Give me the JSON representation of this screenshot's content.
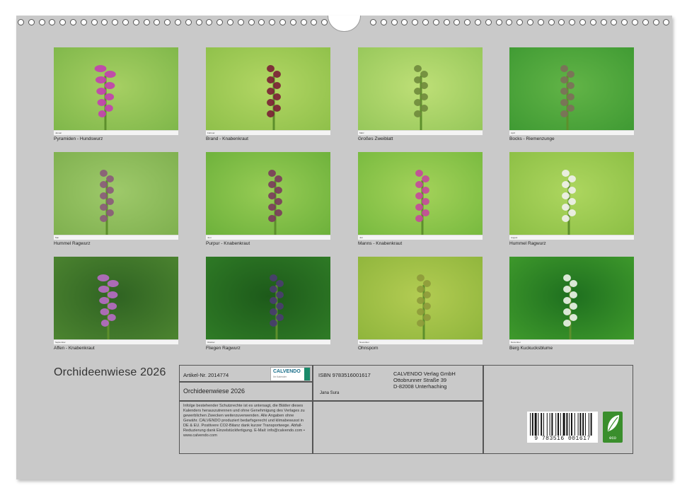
{
  "calendar": {
    "title": "Orchideenwiese  2026"
  },
  "photos": [
    {
      "caption": "Pyramiden - Hundswurz",
      "month": "Januar",
      "icon": "pyramid-orchid-with-hawkmoth"
    },
    {
      "caption": "Brand - Knabenkraut",
      "month": "Februar",
      "icon": "burnt-orchid"
    },
    {
      "caption": "Großes Zweiblatt",
      "month": "März",
      "icon": "twayblade"
    },
    {
      "caption": "Bocks - Riemenzunge",
      "month": "April",
      "icon": "lizard-orchid"
    },
    {
      "caption": "Hummel Ragwurz",
      "month": "Mai",
      "icon": "bee-orchid"
    },
    {
      "caption": "Purpur - Knabenkraut",
      "month": "Juni",
      "icon": "lady-orchid"
    },
    {
      "caption": "Manns - Knabenkraut",
      "month": "Juli",
      "icon": "early-purple-orchid"
    },
    {
      "caption": "Hummel Ragwurz",
      "month": "August",
      "icon": "bee-orchid-pair"
    },
    {
      "caption": "Affen - Knabenkraut",
      "month": "September",
      "icon": "monkey-orchid"
    },
    {
      "caption": "Fliegen Ragwurz",
      "month": "Oktober",
      "icon": "fly-orchid"
    },
    {
      "caption": "Ohnsporn",
      "month": "November",
      "icon": "man-orchid"
    },
    {
      "caption": "Berg Kuckucksblume",
      "month": "Dezember",
      "icon": "butterfly-orchid"
    }
  ],
  "info": {
    "article": "Artikel-Nr. 2014774",
    "title": "Orchideenwiese  2026",
    "isbn": "ISBN 9783516001617",
    "publisher": [
      "CALVENDO Verlag GmbH",
      "Ottobrunner Straße 39",
      "D-82008 Unterhaching"
    ],
    "author": "Jana Sura",
    "legal": "Infolge bestehender Schutzrechte ist es untersagt, die Blätter dieses Kalenders herauszutrennen und ohne Genehmigung des Verlages zu gewerblichen Zwecken weiterzuverwenden. Alle Angaben ohne Gewähr. CALVENDO produziert bedarfsgerecht und klimabewusst in DE & EU. Positivere CO2-Bilanz dank kurzer Transportwege. Abfall-Reduzierung dank Einzelstückfertigung. E-Mail: info@calvendo.com • www.calvendo.com",
    "logo_text": "CALVENDO",
    "logo_sub": "Ihr Kalender",
    "barcode_digits": "9 783516 001617",
    "eco_label": "eco"
  },
  "colors": {
    "page": "#c9c9c9",
    "logo": "#1a8a6a",
    "eco": "#3a8e2c"
  }
}
